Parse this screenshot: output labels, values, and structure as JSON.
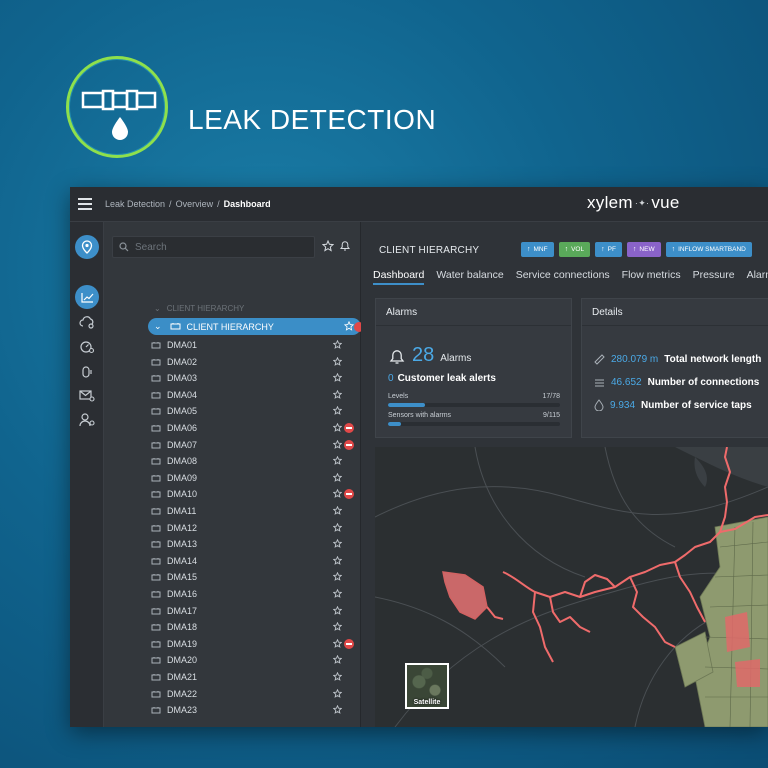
{
  "hero": {
    "title": "LEAK DETECTION"
  },
  "topbar": {
    "breadcrumb": [
      "Leak Detection",
      "Overview",
      "Dashboard"
    ],
    "logo_left": "xylem",
    "logo_right": "vue"
  },
  "rail": {
    "items": [
      {
        "icon": "location-pin-icon",
        "active": true
      },
      {
        "icon": "trend-chart-icon",
        "active": true
      },
      {
        "icon": "cloud-gear-icon",
        "active": false
      },
      {
        "icon": "gauge-settings-icon",
        "active": false
      },
      {
        "icon": "sensor-icon",
        "active": false
      },
      {
        "icon": "mail-settings-icon",
        "active": false
      },
      {
        "icon": "user-settings-icon",
        "active": false
      }
    ]
  },
  "tree": {
    "search_placeholder": "Search",
    "root_label": "CLIENT HIERARCHY",
    "selected_label": "CLIENT HIERARCHY",
    "items": [
      {
        "label": "DMA01",
        "alert": false
      },
      {
        "label": "DMA02",
        "alert": false
      },
      {
        "label": "DMA03",
        "alert": false
      },
      {
        "label": "DMA04",
        "alert": false
      },
      {
        "label": "DMA05",
        "alert": false
      },
      {
        "label": "DMA06",
        "alert": true
      },
      {
        "label": "DMA07",
        "alert": true
      },
      {
        "label": "DMA08",
        "alert": false
      },
      {
        "label": "DMA09",
        "alert": false
      },
      {
        "label": "DMA10",
        "alert": true
      },
      {
        "label": "DMA11",
        "alert": false
      },
      {
        "label": "DMA12",
        "alert": false
      },
      {
        "label": "DMA13",
        "alert": false
      },
      {
        "label": "DMA14",
        "alert": false
      },
      {
        "label": "DMA15",
        "alert": false
      },
      {
        "label": "DMA16",
        "alert": false
      },
      {
        "label": "DMA17",
        "alert": false
      },
      {
        "label": "DMA18",
        "alert": false
      },
      {
        "label": "DMA19",
        "alert": true
      },
      {
        "label": "DMA20",
        "alert": false
      },
      {
        "label": "DMA21",
        "alert": false
      },
      {
        "label": "DMA22",
        "alert": false
      },
      {
        "label": "DMA23",
        "alert": false
      }
    ]
  },
  "main": {
    "title": "CLIENT HIERARCHY",
    "chips": [
      {
        "label": "MNF",
        "color": "#3d8fc9"
      },
      {
        "label": "VOL",
        "color": "#5aa95a"
      },
      {
        "label": "PF",
        "color": "#3d8fc9"
      },
      {
        "label": "NEW",
        "color": "#8a63c9"
      },
      {
        "label": "INFLOW SMARTBAND",
        "color": "#3d8fc9"
      }
    ],
    "tabs": [
      "Dashboard",
      "Water balance",
      "Service connections",
      "Flow metrics",
      "Pressure",
      "Alarms"
    ],
    "active_tab": "Dashboard"
  },
  "alarms": {
    "title": "Alarms",
    "count": "28",
    "count_label": "Alarms",
    "leak_alerts_count": "0",
    "leak_alerts_label": "Customer leak alerts",
    "levels_label": "Levels",
    "levels_value": "17/78",
    "levels_fraction": 0.218,
    "sensors_label": "Sensors with alarms",
    "sensors_value": "9/115",
    "sensors_fraction": 0.078
  },
  "details": {
    "title": "Details",
    "rows": [
      {
        "value": "280.079 m",
        "label": "Total network length",
        "icon": "ruler-icon"
      },
      {
        "value": "46.652",
        "label": "Number of connections",
        "icon": "connections-icon"
      },
      {
        "value": "9.934",
        "label": "Number of service taps",
        "icon": "drop-icon"
      }
    ]
  },
  "map": {
    "layer_button": "Satellite"
  },
  "colors": {
    "accent": "#3d8fc9",
    "alert": "#e04848",
    "network": "#e96a6a",
    "hero_ring": "#8ee04c"
  }
}
